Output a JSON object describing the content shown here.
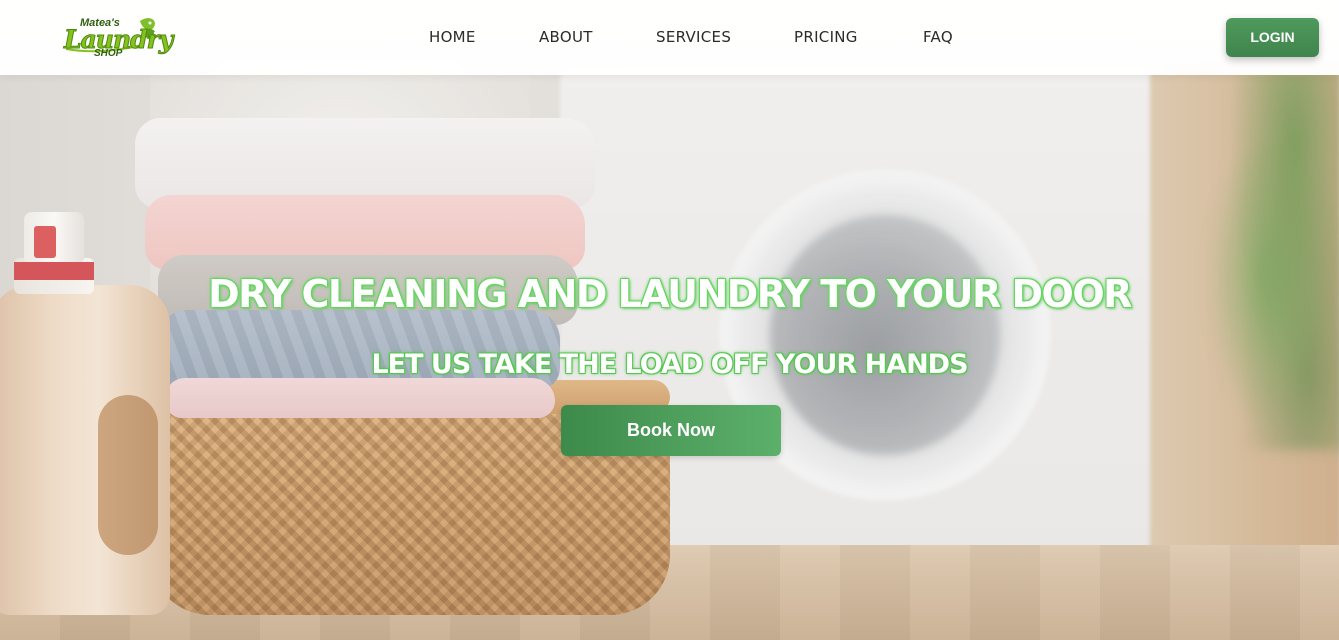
{
  "brand": {
    "logo_top": "Matea's",
    "logo_main": "Laundry",
    "logo_bottom": "SHOP",
    "accent_color": "#4a9458"
  },
  "nav": {
    "items": [
      {
        "label": "HOME"
      },
      {
        "label": "ABOUT"
      },
      {
        "label": "SERVICES"
      },
      {
        "label": "PRICING"
      },
      {
        "label": "FAQ"
      }
    ],
    "login_label": "LOGIN"
  },
  "hero": {
    "title": "DRY CLEANING AND LAUNDRY TO YOUR DOOR",
    "subtitle": "LET US TAKE THE LOAD OFF YOUR HANDS",
    "cta_label": "Book Now",
    "background_image": "laundry-basket-with-folded-clothes"
  }
}
